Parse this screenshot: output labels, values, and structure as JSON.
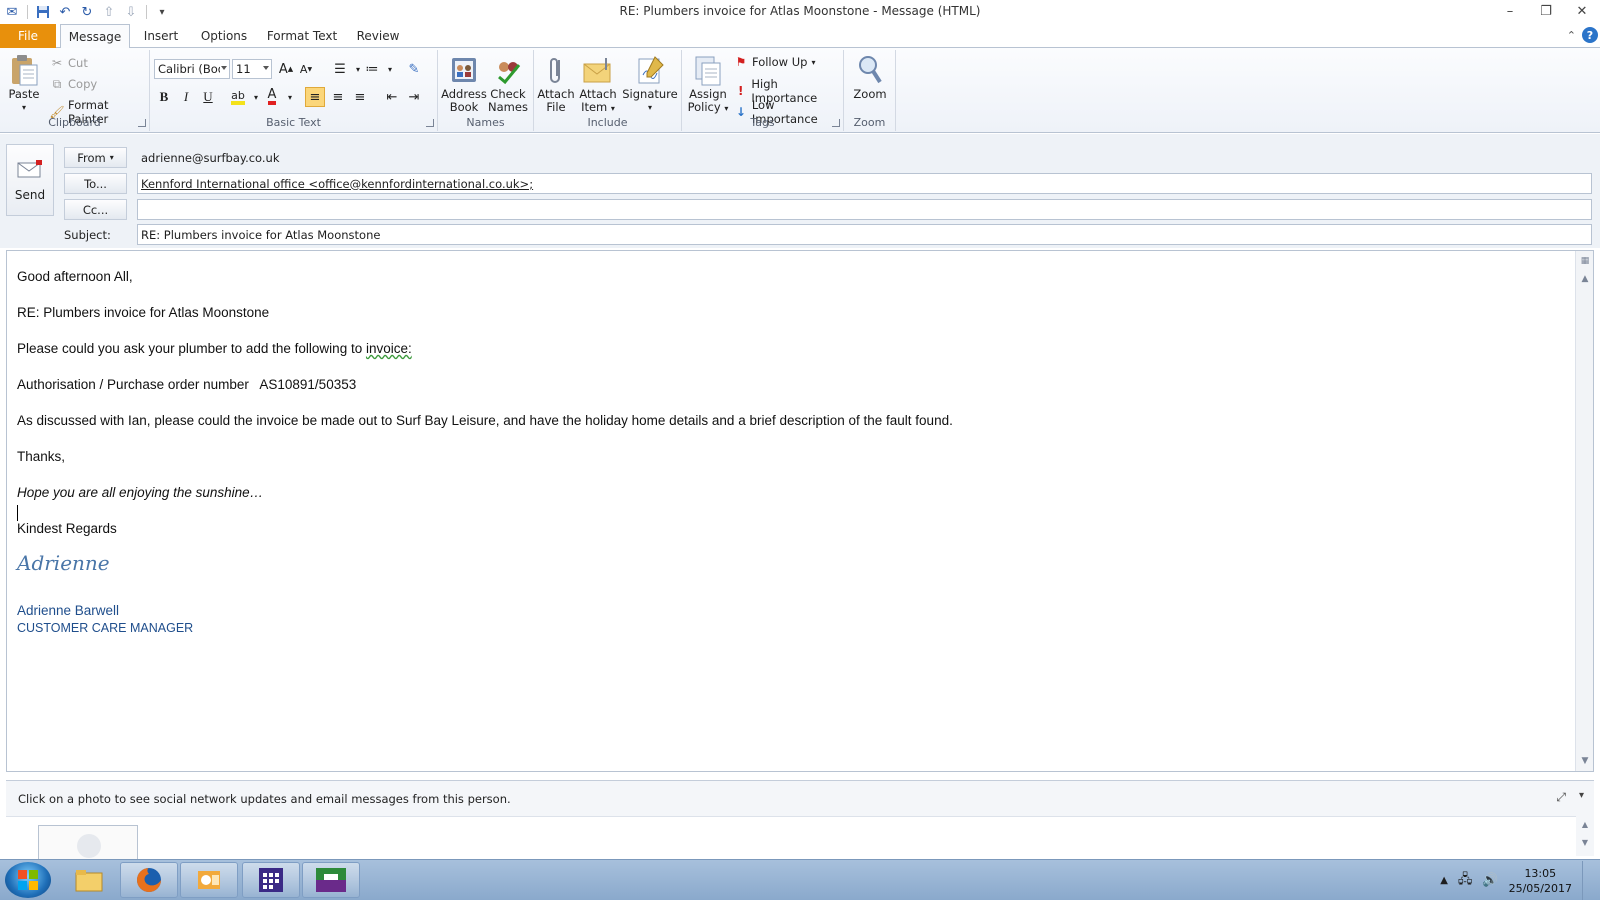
{
  "window": {
    "title": "RE: Plumbers invoice for Atlas Moonstone  -  Message (HTML)"
  },
  "tabs": [
    "File",
    "Message",
    "Insert",
    "Options",
    "Format Text",
    "Review"
  ],
  "ribbon": {
    "clipboard": {
      "label": "Clipboard",
      "paste": "Paste",
      "cut": "Cut",
      "copy": "Copy",
      "format_painter": "Format Painter"
    },
    "basic_text": {
      "label": "Basic Text",
      "font": "Calibri (Body)",
      "size": "11"
    },
    "names": {
      "label": "Names",
      "address_book": [
        "Address",
        "Book"
      ],
      "check_names": [
        "Check",
        "Names"
      ]
    },
    "include": {
      "label": "Include",
      "attach_file": [
        "Attach",
        "File"
      ],
      "attach_item": [
        "Attach",
        "Item"
      ],
      "signature": "Signature"
    },
    "tags": {
      "label": "Tags",
      "assign_policy": [
        "Assign",
        "Policy"
      ],
      "follow_up": "Follow Up",
      "high_importance": "High Importance",
      "low_importance": "Low Importance"
    },
    "zoom": {
      "label": "Zoom",
      "zoom": "Zoom"
    }
  },
  "header": {
    "send": "Send",
    "from_label": "From",
    "from_value": "adrienne@surfbay.co.uk",
    "to_label": "To...",
    "to_value": "Kennford International office <office@kennfordinternational.co.uk>;",
    "cc_label": "Cc...",
    "cc_value": "",
    "subject_label": "Subject:",
    "subject_value": "RE: Plumbers invoice for Atlas Moonstone"
  },
  "body": {
    "greeting": "Good afternoon All,",
    "re_line": "RE: Plumbers invoice for Atlas Moonstone",
    "request_prefix": "Please could you ask your plumber to add the following to ",
    "request_link": "invoice:",
    "po_line": "Authorisation / Purchase order number   AS10891/50353",
    "discussion": "As discussed with Ian, please could the invoice be made out to Surf Bay Leisure, and have the holiday home details and a brief description of the fault found.",
    "thanks": "Thanks,",
    "sunshine": "Hope you are all enjoying the sunshine…",
    "regards": "Kindest Regards",
    "signature_script": "Adrienne",
    "sender_name": "Adrienne Barwell",
    "sender_title": "CUSTOMER CARE MANAGER"
  },
  "people_pane": {
    "info": "Click on a photo to see social network updates and email messages from this person."
  },
  "taskbar": {
    "time": "13:05",
    "date": "25/05/2017"
  }
}
